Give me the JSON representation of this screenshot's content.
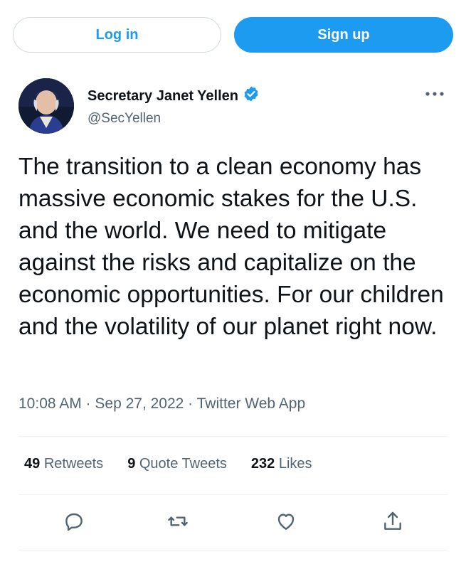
{
  "auth": {
    "login_label": "Log in",
    "signup_label": "Sign up"
  },
  "tweet": {
    "author_name": "Secretary Janet Yellen",
    "author_handle": "@SecYellen",
    "verified_icon": "verified-badge-icon",
    "text": "The transition to a clean economy has massive economic stakes for the U.S. and the world. We need to mitigate against the risks and capitalize on the economic opportunities. For our children and the volatility of our planet right now.",
    "timestamp": "10:08 AM · Sep 27, 2022 · Twitter Web App"
  },
  "stats": {
    "retweets_count": "49",
    "retweets_label": "Retweets",
    "quotes_count": "9",
    "quotes_label": "Quote Tweets",
    "likes_count": "232",
    "likes_label": "Likes"
  },
  "actions": {
    "reply_icon": "reply-icon",
    "retweet_icon": "retweet-icon",
    "like_icon": "heart-icon",
    "share_icon": "share-icon"
  },
  "colors": {
    "accent": "#1d9bf0",
    "text": "#0f1419",
    "secondary": "#536471",
    "border": "#cfd9de"
  }
}
